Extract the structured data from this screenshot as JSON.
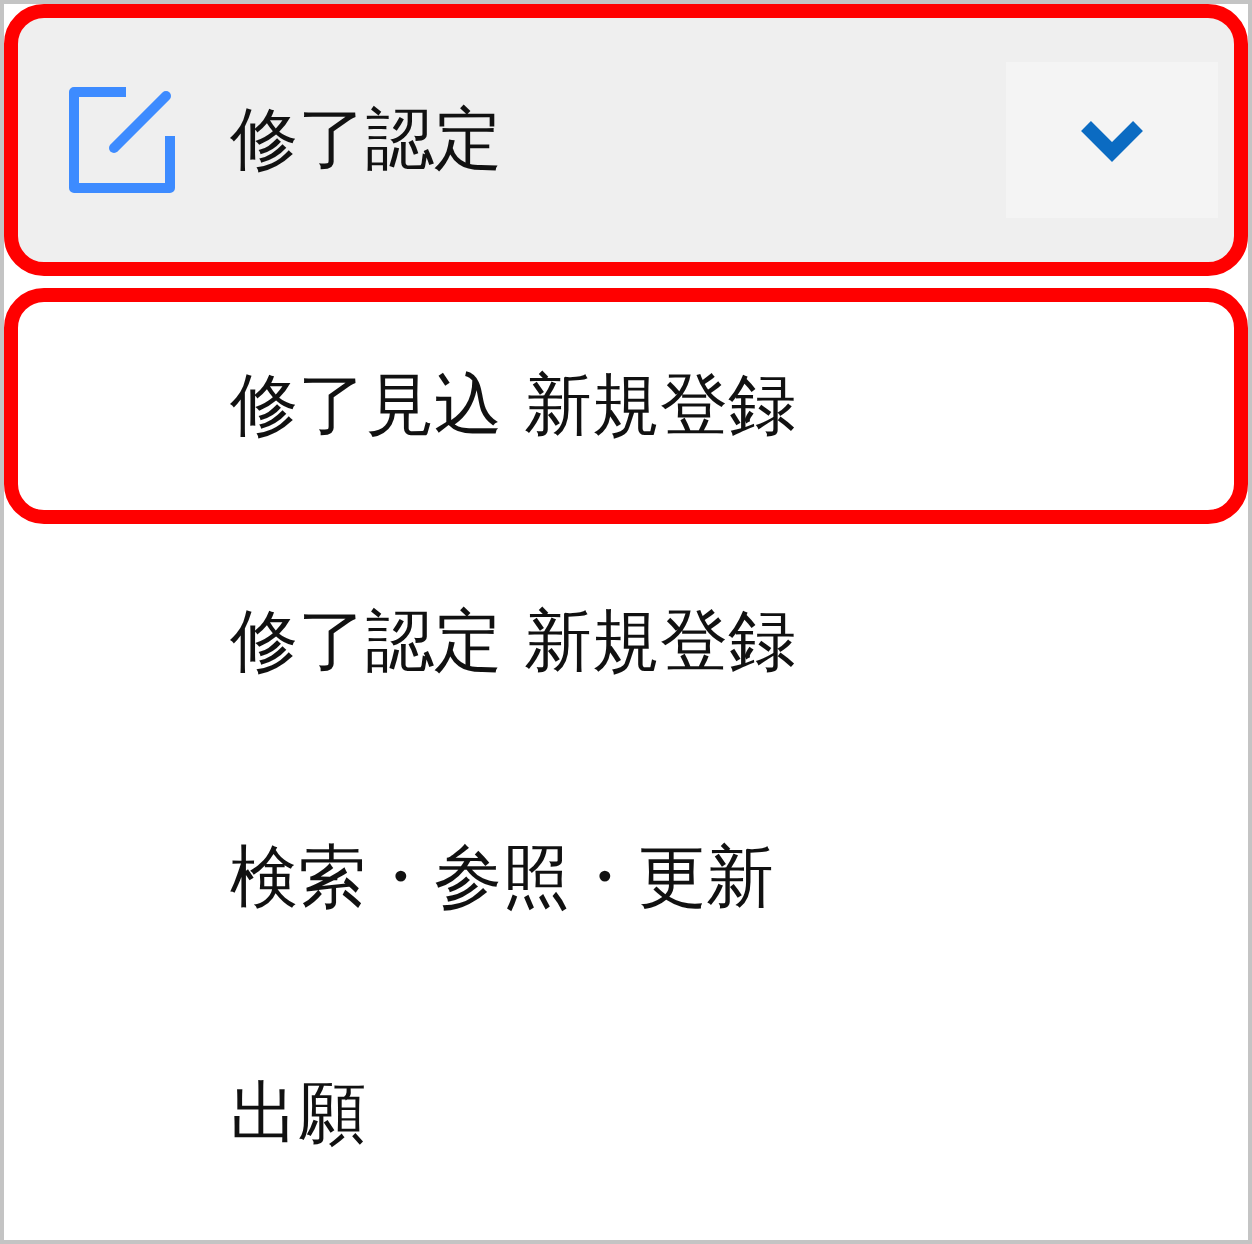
{
  "header": {
    "title": "修了認定",
    "expanded": true,
    "highlighted": true
  },
  "items": [
    {
      "label": "修了見込 新規登録",
      "highlighted": true
    },
    {
      "label": "修了認定 新規登録",
      "highlighted": false
    },
    {
      "label": "検索・参照・更新",
      "highlighted": false
    },
    {
      "label": "出願",
      "highlighted": false
    }
  ]
}
